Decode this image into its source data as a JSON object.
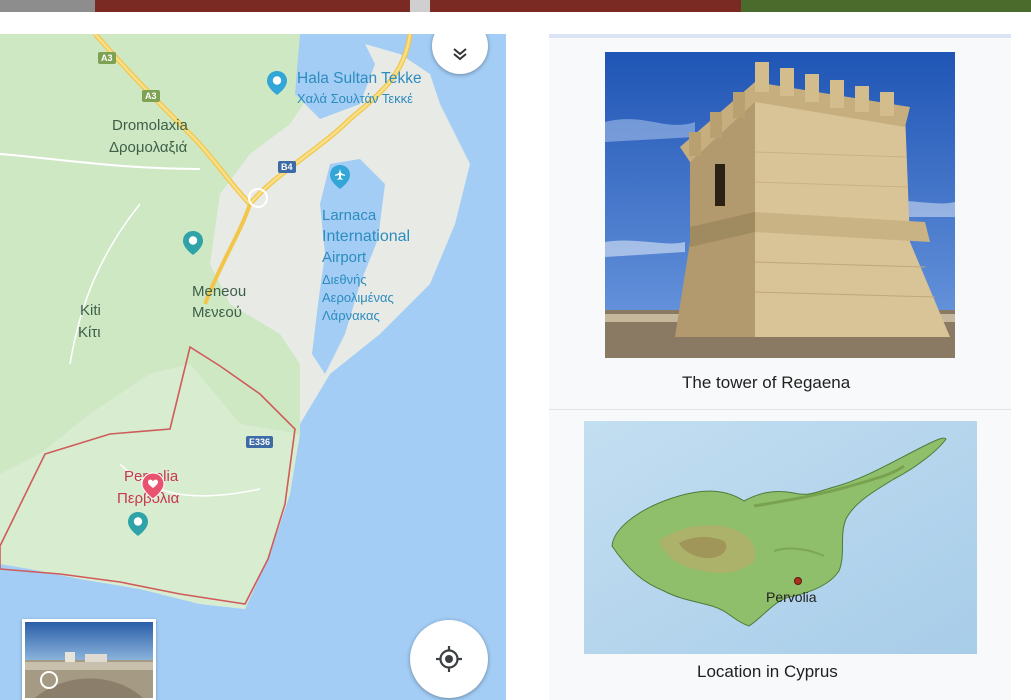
{
  "map": {
    "places": {
      "hala_sultan_en": "Hala Sultan Tekke",
      "hala_sultan_el": "Χαλά Σουλτάν Τεκκέ",
      "dromolaxia_en": "Dromolaxia",
      "dromolaxia_el": "Δρομολαξιά",
      "airport_en_1": "Larnaca",
      "airport_en_2": "International",
      "airport_en_3": "Airport",
      "airport_el_1": "Διεθνής",
      "airport_el_2": "Αερολιμένας",
      "airport_el_3": "Λάρνακας",
      "meneou_en": "Meneou",
      "meneou_el": "Μενεού",
      "kiti_en": "Kiti",
      "kiti_el": "Κίτι",
      "pervolia_en": "Pervolia",
      "pervolia_el": "Περβόλια"
    },
    "roads": {
      "a3_top": "A3",
      "a3_mid": "A3",
      "b4": "B4",
      "e336": "E336"
    },
    "icons": {
      "layers": "layers-icon",
      "locate": "my-location-icon",
      "place_pin": "place-pin-icon",
      "airport_pin": "airport-icon",
      "selected_pin": "heart-pin-icon"
    },
    "colors": {
      "land": "#e8eae6",
      "green": "#cfe8c4",
      "water": "#a3cdf5",
      "road": "#f6d66b",
      "highlight_border": "#cf5b5b"
    }
  },
  "panel": {
    "photo_caption": "The tower of Regaena",
    "map_caption": "Location in Cyprus",
    "map_marker_label": "Pervolia"
  }
}
